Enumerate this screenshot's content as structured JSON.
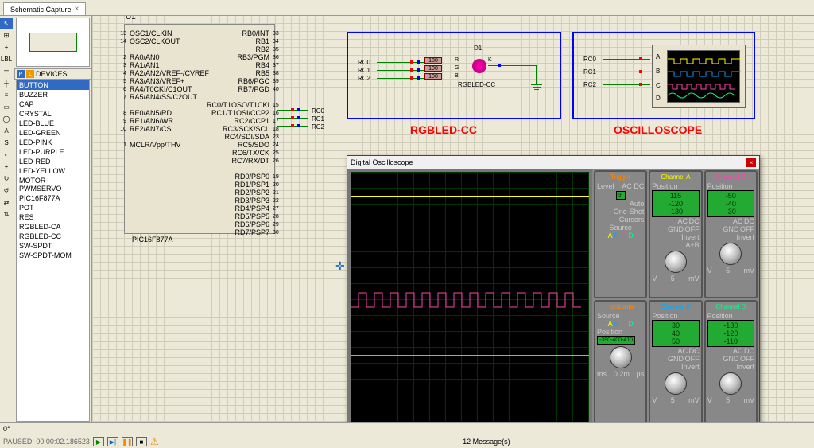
{
  "tab": {
    "title": "Schematic Capture",
    "close": "×"
  },
  "sidebar": {
    "header": "DEVICES",
    "p_icon": "P",
    "l_icon": "L",
    "items": [
      "BUTTON",
      "BUZZER",
      "CAP",
      "CRYSTAL",
      "LED-BLUE",
      "LED-GREEN",
      "LED-PINK",
      "LED-PURPLE",
      "LED-RED",
      "LED-YELLOW",
      "MOTOR-PWMSERVO",
      "PIC16F877A",
      "POT",
      "RES",
      "RGBLED-CA",
      "RGBLED-CC",
      "SW-SPDT",
      "SW-SPDT-MOM"
    ],
    "selected_index": 0
  },
  "chip": {
    "ref": "U1",
    "name": "PIC16F877A",
    "left_pins": [
      {
        "num": "13",
        "label": "OSC1/CLKIN"
      },
      {
        "num": "14",
        "label": "OSC2/CLKOUT"
      },
      {
        "num": "",
        "label": ""
      },
      {
        "num": "2",
        "label": "RA0/AN0"
      },
      {
        "num": "3",
        "label": "RA1/AN1"
      },
      {
        "num": "4",
        "label": "RA2/AN2/VREF-/CVREF"
      },
      {
        "num": "5",
        "label": "RA3/AN3/VREF+"
      },
      {
        "num": "6",
        "label": "RA4/T0CKI/C1OUT"
      },
      {
        "num": "7",
        "label": "RA5/AN4/SS/C2OUT"
      },
      {
        "num": "",
        "label": ""
      },
      {
        "num": "8",
        "label": "RE0/AN5/RD"
      },
      {
        "num": "9",
        "label": "RE1/AN6/WR"
      },
      {
        "num": "10",
        "label": "RE2/AN7/CS"
      },
      {
        "num": "",
        "label": ""
      },
      {
        "num": "1",
        "label": "MCLR/Vpp/THV"
      }
    ],
    "right_pins": [
      {
        "num": "33",
        "label": "RB0/INT"
      },
      {
        "num": "34",
        "label": "RB1"
      },
      {
        "num": "35",
        "label": "RB2"
      },
      {
        "num": "36",
        "label": "RB3/PGM"
      },
      {
        "num": "37",
        "label": "RB4"
      },
      {
        "num": "38",
        "label": "RB5"
      },
      {
        "num": "39",
        "label": "RB6/PGC"
      },
      {
        "num": "40",
        "label": "RB7/PGD"
      },
      {
        "num": "",
        "label": ""
      },
      {
        "num": "15",
        "label": "RC0/T1OSO/T1CKI"
      },
      {
        "num": "16",
        "label": "RC1/T1OSI/CCP2"
      },
      {
        "num": "17",
        "label": "RC2/CCP1"
      },
      {
        "num": "18",
        "label": "RC3/SCK/SCL"
      },
      {
        "num": "23",
        "label": "RC4/SDI/SDA"
      },
      {
        "num": "24",
        "label": "RC5/SDO"
      },
      {
        "num": "25",
        "label": "RC6/TX/CK"
      },
      {
        "num": "26",
        "label": "RC7/RX/DT"
      },
      {
        "num": "",
        "label": ""
      },
      {
        "num": "19",
        "label": "RD0/PSP0"
      },
      {
        "num": "20",
        "label": "RD1/PSP1"
      },
      {
        "num": "21",
        "label": "RD2/PSP2"
      },
      {
        "num": "22",
        "label": "RD3/PSP3"
      },
      {
        "num": "27",
        "label": "RD4/PSP4"
      },
      {
        "num": "28",
        "label": "RD5/PSP5"
      },
      {
        "num": "29",
        "label": "RD6/PSP6"
      },
      {
        "num": "30",
        "label": "RD7/PSP7"
      }
    ]
  },
  "nets": {
    "rc0": "RC0",
    "rc1": "RC1",
    "rc2": "RC2"
  },
  "led_block": {
    "title": "RGBLED-CC",
    "ref": "D1",
    "name": "RGBLED-CC",
    "r1": "180",
    "r2": "100",
    "r3": "100",
    "pinR": "R",
    "pinG": "G",
    "pinB": "B",
    "pinK": "K"
  },
  "scope_block": {
    "title": "OSCILLOSCOPE",
    "chA": "A",
    "chB": "B",
    "chC": "C",
    "chD": "D"
  },
  "scope": {
    "title": "Digital Oscilloscope",
    "trigger": {
      "title": "Trigger",
      "level": "Level",
      "ac": "AC",
      "dc": "DC",
      "auto": "Auto",
      "oneshot": "One-Shot",
      "cursors": "Cursors",
      "source": "Source",
      "val": "9.",
      "abcd": "A B C D"
    },
    "horizontal": {
      "title": "Horizontal",
      "source": "Source",
      "position": "Position",
      "val": "-390-400-410",
      "abcd": "A B C D",
      "unit1": "ms",
      "unit2": "0.2m",
      "unit3": "µs"
    },
    "chA": {
      "title": "Channel A",
      "position": "Position",
      "val1": "115",
      "val2": "-120",
      "val3": "-130",
      "ac": "AC",
      "dc": "DC",
      "gnd": "GND",
      "off": "OFF",
      "invert": "Invert",
      "ab": "A+B",
      "unit1": "V",
      "unit2": "5",
      "unit3": "mV"
    },
    "chB": {
      "title": "Channel B",
      "position": "Position",
      "val1": "30",
      "val2": "40",
      "val3": "50",
      "ac": "AC",
      "dc": "DC",
      "gnd": "GND",
      "off": "OFF",
      "invert": "Invert",
      "unit1": "V",
      "unit2": "5",
      "unit3": "mV"
    },
    "chC": {
      "title": "Channel C",
      "position": "Position",
      "val1": "-50",
      "val2": "-40",
      "val3": "-30",
      "ac": "AC",
      "dc": "DC",
      "gnd": "GND",
      "off": "OFF",
      "invert": "Invert",
      "unit1": "V",
      "unit2": "5",
      "unit3": "mV"
    },
    "chD": {
      "title": "Channel D",
      "position": "Position",
      "val1": "-130",
      "val2": "-120",
      "val3": "-110",
      "ac": "AC",
      "dc": "DC",
      "gnd": "GND",
      "off": "OFF",
      "invert": "Invert",
      "unit1": "V",
      "unit2": "5",
      "unit3": "mV"
    }
  },
  "footer": {
    "paused": "PAUSED: 00:00:02.186523",
    "messages": "12 Message(s)",
    "angle": "0°",
    "warn": "⚠"
  },
  "tools": [
    "↖",
    "⊞",
    "+",
    "LBL",
    "═",
    "┼",
    "≡",
    "▭",
    "◯",
    "A",
    "S",
    "◐",
    "+",
    "↻",
    "↺",
    "⇄",
    "⇅"
  ]
}
